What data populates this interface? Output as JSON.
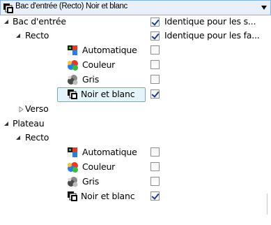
{
  "combo": {
    "value": "Bac d'entrée (Recto) Noir et blanc",
    "icon": "black-white-icon"
  },
  "tree": {
    "bac": {
      "label": "Bac d'entrée",
      "same_label": "Identique pour les s...",
      "recto_label": "Recto",
      "recto_same_label": "Identique pour les fa...",
      "items": [
        {
          "label": "Automatique",
          "icon": "auto-color-icon",
          "checked": false
        },
        {
          "label": "Couleur",
          "icon": "color-icon",
          "checked": false
        },
        {
          "label": "Gris",
          "icon": "gray-icon",
          "checked": false
        },
        {
          "label": "Noir et blanc",
          "icon": "black-white-icon",
          "checked": true,
          "selected": true
        }
      ],
      "verso_label": "Verso"
    },
    "plateau": {
      "label": "Plateau",
      "recto_label": "Recto",
      "items": [
        {
          "label": "Automatique",
          "icon": "auto-color-icon",
          "checked": false
        },
        {
          "label": "Couleur",
          "icon": "color-icon",
          "checked": false
        },
        {
          "label": "Gris",
          "icon": "gray-icon",
          "checked": false
        },
        {
          "label": "Noir et blanc",
          "icon": "black-white-icon",
          "checked": true
        }
      ]
    }
  }
}
